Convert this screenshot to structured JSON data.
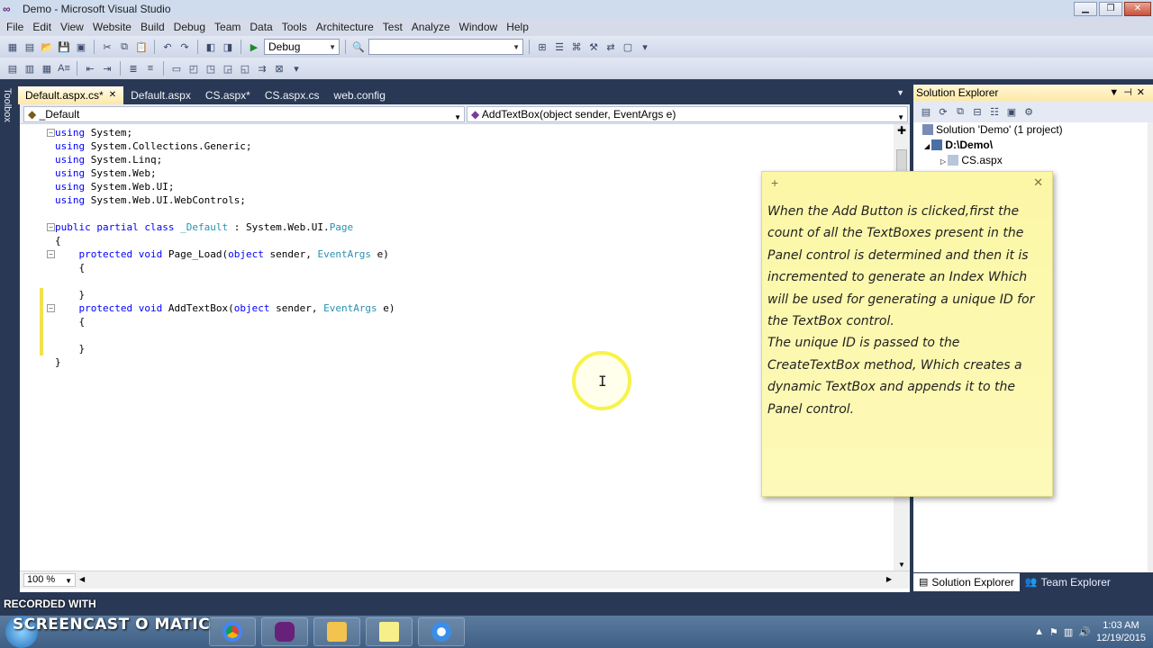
{
  "window": {
    "title": "Demo - Microsoft Visual Studio"
  },
  "menu": [
    "File",
    "Edit",
    "View",
    "Website",
    "Build",
    "Debug",
    "Team",
    "Data",
    "Tools",
    "Architecture",
    "Test",
    "Analyze",
    "Window",
    "Help"
  ],
  "toolbar": {
    "config": "Debug",
    "platform": ""
  },
  "toolbox_label": "Toolbox",
  "tabs": [
    {
      "label": "Default.aspx.cs*",
      "active": true,
      "closable": true
    },
    {
      "label": "Default.aspx",
      "active": false
    },
    {
      "label": "CS.aspx*",
      "active": false
    },
    {
      "label": "CS.aspx.cs",
      "active": false
    },
    {
      "label": "web.config",
      "active": false
    }
  ],
  "nav": {
    "class_select": "_Default",
    "member_select": "AddTextBox(object sender, EventArgs e)"
  },
  "code_lines": [
    [
      {
        "t": "using",
        "c": "kw"
      },
      {
        "t": " System;",
        "c": "plain"
      }
    ],
    [
      {
        "t": "using",
        "c": "kw"
      },
      {
        "t": " System.Collections.Generic;",
        "c": "plain"
      }
    ],
    [
      {
        "t": "using",
        "c": "kw"
      },
      {
        "t": " System.Linq;",
        "c": "plain"
      }
    ],
    [
      {
        "t": "using",
        "c": "kw"
      },
      {
        "t": " System.Web;",
        "c": "plain"
      }
    ],
    [
      {
        "t": "using",
        "c": "kw"
      },
      {
        "t": " System.Web.UI;",
        "c": "plain"
      }
    ],
    [
      {
        "t": "using",
        "c": "kw"
      },
      {
        "t": " System.Web.UI.WebControls;",
        "c": "plain"
      }
    ],
    [],
    [
      {
        "t": "public",
        "c": "kw"
      },
      {
        "t": " ",
        "c": "plain"
      },
      {
        "t": "partial",
        "c": "kw"
      },
      {
        "t": " ",
        "c": "plain"
      },
      {
        "t": "class",
        "c": "kw"
      },
      {
        "t": " ",
        "c": "plain"
      },
      {
        "t": "_Default",
        "c": "ty"
      },
      {
        "t": " : System.Web.UI.",
        "c": "plain"
      },
      {
        "t": "Page",
        "c": "ty"
      }
    ],
    [
      {
        "t": "{",
        "c": "plain"
      }
    ],
    [
      {
        "t": "    ",
        "c": "plain"
      },
      {
        "t": "protected",
        "c": "kw"
      },
      {
        "t": " ",
        "c": "plain"
      },
      {
        "t": "void",
        "c": "kw"
      },
      {
        "t": " Page_Load(",
        "c": "plain"
      },
      {
        "t": "object",
        "c": "kw"
      },
      {
        "t": " sender, ",
        "c": "plain"
      },
      {
        "t": "EventArgs",
        "c": "ty"
      },
      {
        "t": " e)",
        "c": "plain"
      }
    ],
    [
      {
        "t": "    {",
        "c": "plain"
      }
    ],
    [],
    [
      {
        "t": "    }",
        "c": "plain"
      }
    ],
    [
      {
        "t": "    ",
        "c": "plain"
      },
      {
        "t": "protected",
        "c": "kw"
      },
      {
        "t": " ",
        "c": "plain"
      },
      {
        "t": "void",
        "c": "kw"
      },
      {
        "t": " AddTextBox(",
        "c": "plain"
      },
      {
        "t": "object",
        "c": "kw"
      },
      {
        "t": " sender, ",
        "c": "plain"
      },
      {
        "t": "EventArgs",
        "c": "ty"
      },
      {
        "t": " e)",
        "c": "plain"
      }
    ],
    [
      {
        "t": "    {",
        "c": "plain"
      }
    ],
    [],
    [
      {
        "t": "    }",
        "c": "plain"
      }
    ],
    [
      {
        "t": "}",
        "c": "plain"
      }
    ]
  ],
  "zoom": "100 %",
  "sticky_note": {
    "lines": [
      "When the Add Button is clicked,first the",
      "count of all the TextBoxes present in the",
      "Panel control is determined and then it is",
      "incremented to generate an Index Which",
      "will be used for generating a unique ID for",
      "the TextBox control.",
      "The unique ID is passed to the",
      "CreateTextBox method, Which creates a",
      "dynamic TextBox and appends it to the",
      "Panel control."
    ]
  },
  "solution_explorer": {
    "title": "Solution Explorer",
    "tree": [
      {
        "label": "Solution 'Demo' (1 project)"
      },
      {
        "label": "D:\\Demo\\"
      },
      {
        "label": "CS.aspx"
      }
    ],
    "tabs": [
      "Solution Explorer",
      "Team Explorer"
    ]
  },
  "watermark": {
    "recorded": "RECORDED WITH",
    "brand": "SCREENCAST O MATIC"
  },
  "tray": {
    "time": "1:03 AM",
    "date": "12/19/2015"
  }
}
